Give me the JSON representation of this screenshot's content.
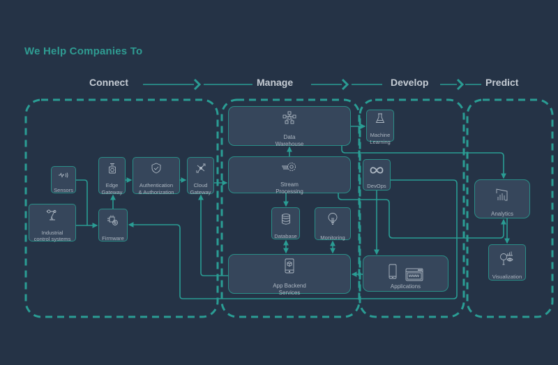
{
  "title": "We Help Companies To",
  "stages": [
    {
      "label": "Connect"
    },
    {
      "label": "Manage"
    },
    {
      "label": "Develop"
    },
    {
      "label": "Predict"
    }
  ],
  "nodes": {
    "sensors": {
      "label": "Sensors",
      "icon": "sensor-wave-icon"
    },
    "industrial": {
      "label": "Industrial\ncontrol systems",
      "icon": "robot-arm-icon"
    },
    "edge_gateway": {
      "label": "Edge\nGateway",
      "icon": "router-icon"
    },
    "firmware": {
      "label": "Firmware",
      "icon": "chip-gear-icon"
    },
    "auth": {
      "label": "Authentication\n& Authorization",
      "icon": "shield-check-icon"
    },
    "cloud_gateway": {
      "label": "Cloud\nGateway",
      "icon": "network-hub-icon"
    },
    "data_warehouse": {
      "label": "Data\nWarehouse",
      "icon": "data-network-icon"
    },
    "stream_processing": {
      "label": "Stream\nProcessing",
      "icon": "gear-stream-icon"
    },
    "database": {
      "label": "Database",
      "icon": "database-icon"
    },
    "monitoring": {
      "label": "Monitoring",
      "icon": "lightbulb-icon"
    },
    "app_backend": {
      "label": "App Backend\nServices",
      "icon": "mobile-cube-icon"
    },
    "machine_learning": {
      "label": "Machine\nLearning",
      "icon": "flask-icon"
    },
    "devops": {
      "label": "DevOps",
      "icon": "infinity-icon"
    },
    "applications": {
      "label": "Applications",
      "icons": [
        "smartphone-icon",
        "browser-www-icon"
      ],
      "www_text": "www"
    },
    "analytics": {
      "label": "Analytics",
      "icon": "bar-chart-icon"
    },
    "visualization": {
      "label": "Visualization",
      "icon": "magnifier-chart-eye-icon"
    }
  },
  "colors": {
    "background": "#253346",
    "accent": "#2a9d8f",
    "box_fill": "#36465b",
    "box_text": "#aeb8c3",
    "stage_text": "#c5ccd4"
  }
}
